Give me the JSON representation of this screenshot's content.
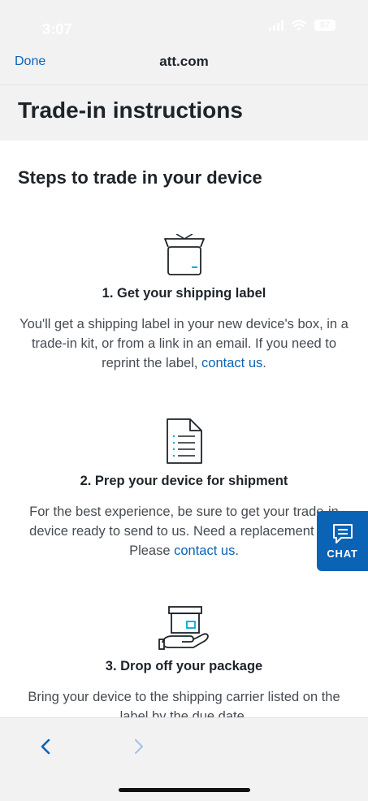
{
  "status_bar": {
    "time": "3:07",
    "battery": "87"
  },
  "browser": {
    "done_label": "Done",
    "site": "att.com"
  },
  "page": {
    "title": "Trade-in instructions"
  },
  "section": {
    "title": "Steps to trade in your device"
  },
  "steps": [
    {
      "icon": "box-icon",
      "title": "1. Get your shipping label",
      "text": "You'll get a shipping label in your new device's box, in a trade-in kit, or from a link in an email. If you need to reprint the label, ",
      "link": "contact us",
      "suffix": "."
    },
    {
      "icon": "document-icon",
      "title": "2. Prep your device for shipment",
      "text": "For the best experience, be sure to get your trade-in device ready to send to us. Need a replacement kit? Please ",
      "link": "contact us",
      "suffix": "."
    },
    {
      "icon": "package-in-hand-icon",
      "title": "3. Drop off your package",
      "text": "Bring your device to the shipping carrier listed on the label by the due date."
    }
  ],
  "chat": {
    "label": "CHAT"
  },
  "colors": {
    "brand_blue": "#0b63b5",
    "accent_cyan": "#00a8e0"
  }
}
